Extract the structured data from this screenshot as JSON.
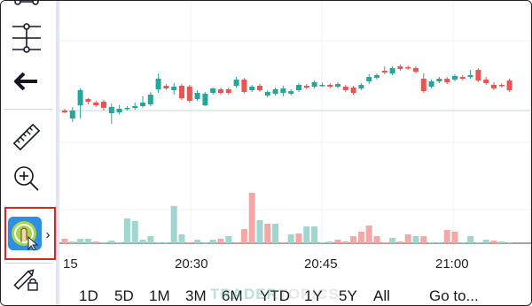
{
  "colors": {
    "up": "#26a69a",
    "down": "#ef5350",
    "up_volume": "#9fd6d0",
    "down_volume": "#f4a8a6",
    "highlight_border": "#e01f26",
    "active_tool_bg": "#2f8fe0"
  },
  "sidebar": {
    "tools": [
      {
        "icon": "branch-icon"
      },
      {
        "icon": "fork-line-icon"
      },
      {
        "icon": "back-arrow-icon"
      },
      {
        "icon": "ruler-icon"
      },
      {
        "icon": "zoom-in-icon"
      },
      {
        "icon": "finger-touch-icon",
        "active": true
      },
      {
        "icon": "lock-pencil-icon"
      }
    ],
    "expand_glyph": "›"
  },
  "time_axis": {
    "labels": [
      "15",
      "20:30",
      "20:45",
      "21:00"
    ]
  },
  "range_buttons": [
    "1D",
    "5D",
    "1M",
    "3M",
    "6M",
    "YTD",
    "1Y",
    "5Y",
    "All",
    "Go to..."
  ],
  "watermark": {
    "main": "TRADER",
    "faint": "TOPICS"
  },
  "chart_data": {
    "type": "candlestick",
    "x": [
      "15",
      "20:30",
      "20:45",
      "21:00"
    ],
    "candles": [
      {
        "o": 124,
        "c": 126,
        "h": 122,
        "l": 127,
        "up": false
      },
      {
        "o": 133,
        "c": 124,
        "h": 120,
        "l": 137,
        "up": true
      },
      {
        "o": 118,
        "c": 101,
        "h": 99,
        "l": 133,
        "up": true
      },
      {
        "o": 111,
        "c": 114,
        "h": 110,
        "l": 117,
        "up": false
      },
      {
        "o": 115,
        "c": 118,
        "h": 113,
        "l": 120,
        "up": false
      },
      {
        "o": 114,
        "c": 121,
        "h": 112,
        "l": 124,
        "up": false
      },
      {
        "o": 127,
        "c": 120,
        "h": 116,
        "l": 139,
        "up": true
      },
      {
        "o": 126,
        "c": 122,
        "h": 118,
        "l": 128,
        "up": true
      },
      {
        "o": 122,
        "c": 121,
        "h": 119,
        "l": 124,
        "up": true
      },
      {
        "o": 121,
        "c": 119,
        "h": 115,
        "l": 123,
        "up": true
      },
      {
        "o": 119,
        "c": 115,
        "h": 108,
        "l": 121,
        "up": true
      },
      {
        "o": 117,
        "c": 106,
        "h": 103,
        "l": 119,
        "up": true
      },
      {
        "o": 100,
        "c": 88,
        "h": 82,
        "l": 104,
        "up": true
      },
      {
        "o": 96,
        "c": 99,
        "h": 94,
        "l": 101,
        "up": false
      },
      {
        "o": 101,
        "c": 97,
        "h": 93,
        "l": 106,
        "up": true
      },
      {
        "o": 96,
        "c": 110,
        "h": 94,
        "l": 112,
        "up": false
      },
      {
        "o": 97,
        "c": 113,
        "h": 95,
        "l": 115,
        "up": false
      },
      {
        "o": 111,
        "c": 104,
        "h": 101,
        "l": 113,
        "up": true
      },
      {
        "o": 118,
        "c": 105,
        "h": 103,
        "l": 119,
        "up": true
      },
      {
        "o": 104,
        "c": 99,
        "h": 98,
        "l": 106,
        "up": true
      },
      {
        "o": 100,
        "c": 104,
        "h": 98,
        "l": 106,
        "up": false
      },
      {
        "o": 100,
        "c": 104,
        "h": 98,
        "l": 106,
        "up": false
      },
      {
        "o": 96,
        "c": 89,
        "h": 86,
        "l": 98,
        "up": true
      },
      {
        "o": 89,
        "c": 103,
        "h": 87,
        "l": 105,
        "up": false
      },
      {
        "o": 101,
        "c": 97,
        "h": 95,
        "l": 103,
        "up": true
      },
      {
        "o": 96,
        "c": 101,
        "h": 94,
        "l": 103,
        "up": false
      },
      {
        "o": 107,
        "c": 103,
        "h": 101,
        "l": 109,
        "up": true
      },
      {
        "o": 105,
        "c": 100,
        "h": 98,
        "l": 107,
        "up": true
      },
      {
        "o": 104,
        "c": 99,
        "h": 96,
        "l": 108,
        "up": true
      },
      {
        "o": 105,
        "c": 102,
        "h": 100,
        "l": 107,
        "up": true
      },
      {
        "o": 101,
        "c": 95,
        "h": 93,
        "l": 103,
        "up": true
      },
      {
        "o": 96,
        "c": 98,
        "h": 94,
        "l": 100,
        "up": false
      },
      {
        "o": 97,
        "c": 92,
        "h": 90,
        "l": 99,
        "up": true
      },
      {
        "o": 95,
        "c": 95,
        "h": 92,
        "l": 97,
        "up": true
      },
      {
        "o": 95,
        "c": 97,
        "h": 93,
        "l": 99,
        "up": false
      },
      {
        "o": 97,
        "c": 94,
        "h": 92,
        "l": 99,
        "up": true
      },
      {
        "o": 97,
        "c": 101,
        "h": 95,
        "l": 103,
        "up": false
      },
      {
        "o": 98,
        "c": 104,
        "h": 96,
        "l": 106,
        "up": false
      },
      {
        "o": 99,
        "c": 95,
        "h": 93,
        "l": 101,
        "up": true
      },
      {
        "o": 91,
        "c": 86,
        "h": 83,
        "l": 94,
        "up": true
      },
      {
        "o": 87,
        "c": 84,
        "h": 82,
        "l": 89,
        "up": true
      },
      {
        "o": 79,
        "c": 81,
        "h": 74,
        "l": 83,
        "up": false
      },
      {
        "o": 82,
        "c": 76,
        "h": 74,
        "l": 84,
        "up": true
      },
      {
        "o": 74,
        "c": 77,
        "h": 72,
        "l": 79,
        "up": false
      },
      {
        "o": 76,
        "c": 75,
        "h": 73,
        "l": 78,
        "up": false
      },
      {
        "o": 76,
        "c": 80,
        "h": 74,
        "l": 82,
        "up": false
      },
      {
        "o": 88,
        "c": 102,
        "h": 82,
        "l": 104,
        "up": false
      },
      {
        "o": 97,
        "c": 91,
        "h": 89,
        "l": 99,
        "up": true
      },
      {
        "o": 91,
        "c": 88,
        "h": 86,
        "l": 93,
        "up": true
      },
      {
        "o": 88,
        "c": 92,
        "h": 86,
        "l": 94,
        "up": false
      },
      {
        "o": 89,
        "c": 85,
        "h": 83,
        "l": 91,
        "up": true
      },
      {
        "o": 86,
        "c": 88,
        "h": 84,
        "l": 90,
        "up": false
      },
      {
        "o": 86,
        "c": 84,
        "h": 78,
        "l": 88,
        "up": true
      },
      {
        "o": 78,
        "c": 90,
        "h": 76,
        "l": 92,
        "up": false
      },
      {
        "o": 89,
        "c": 93,
        "h": 86,
        "l": 95,
        "up": false
      },
      {
        "o": 95,
        "c": 99,
        "h": 92,
        "l": 101,
        "up": false
      },
      {
        "o": 95,
        "c": 96,
        "h": 93,
        "l": 98,
        "up": false
      },
      {
        "o": 90,
        "c": 101,
        "h": 88,
        "l": 103,
        "up": false
      }
    ],
    "volume": [
      {
        "v": 5,
        "up": false
      },
      {
        "v": 2,
        "up": true
      },
      {
        "v": 5,
        "up": true
      },
      {
        "v": 5,
        "up": true
      },
      {
        "v": 2,
        "up": false
      },
      {
        "v": 1,
        "up": true
      },
      {
        "v": 3,
        "up": true
      },
      {
        "v": 1,
        "up": true
      },
      {
        "v": 28,
        "up": true
      },
      {
        "v": 25,
        "up": true
      },
      {
        "v": 4,
        "up": true
      },
      {
        "v": 8,
        "up": true
      },
      {
        "v": 1,
        "up": true
      },
      {
        "v": 1,
        "up": true
      },
      {
        "v": 42,
        "up": true
      },
      {
        "v": 10,
        "up": true
      },
      {
        "v": 1,
        "up": false
      },
      {
        "v": 4,
        "up": true
      },
      {
        "v": 1,
        "up": true
      },
      {
        "v": 4,
        "up": true
      },
      {
        "v": 5,
        "up": false
      },
      {
        "v": 8,
        "up": true
      },
      {
        "v": 1,
        "up": false
      },
      {
        "v": 16,
        "up": false
      },
      {
        "v": 57,
        "up": false
      },
      {
        "v": 26,
        "up": true
      },
      {
        "v": 22,
        "up": false
      },
      {
        "v": 22,
        "up": true
      },
      {
        "v": 1,
        "up": false
      },
      {
        "v": 10,
        "up": true
      },
      {
        "v": 11,
        "up": false
      },
      {
        "v": 19,
        "up": true
      },
      {
        "v": 19,
        "up": true
      },
      {
        "v": 1,
        "up": true
      },
      {
        "v": 2,
        "up": true
      },
      {
        "v": 4,
        "up": false
      },
      {
        "v": 2,
        "up": false
      },
      {
        "v": 8,
        "up": false
      },
      {
        "v": 13,
        "up": false
      },
      {
        "v": 20,
        "up": false
      },
      {
        "v": 8,
        "up": false
      },
      {
        "v": 1,
        "up": false
      },
      {
        "v": 6,
        "up": true
      },
      {
        "v": 2,
        "up": false
      },
      {
        "v": 10,
        "up": false
      },
      {
        "v": 8,
        "up": true
      },
      {
        "v": 8,
        "up": false
      },
      {
        "v": 1,
        "up": true
      },
      {
        "v": 1,
        "up": true
      },
      {
        "v": 15,
        "up": false
      },
      {
        "v": 13,
        "up": false
      },
      {
        "v": 1,
        "up": true
      },
      {
        "v": 8,
        "up": true
      },
      {
        "v": 1,
        "up": true
      },
      {
        "v": 4,
        "up": true
      },
      {
        "v": 3,
        "up": false
      },
      {
        "v": 2,
        "up": true
      },
      {
        "v": 1,
        "up": true
      }
    ]
  }
}
